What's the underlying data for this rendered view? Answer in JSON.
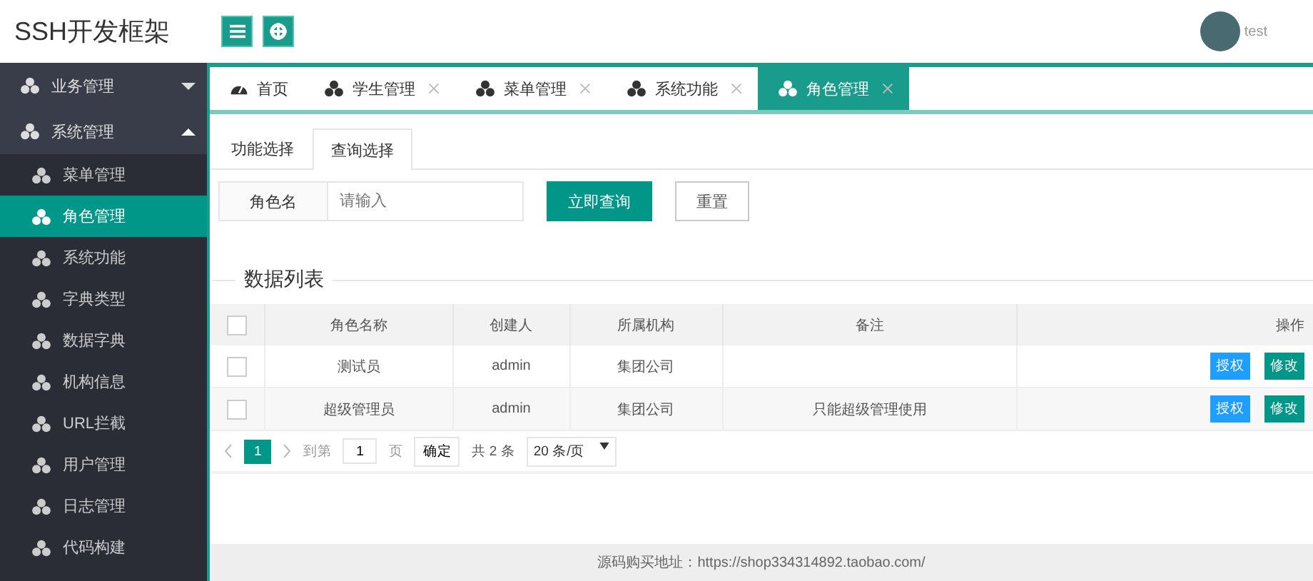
{
  "header": {
    "title": "SSH开发框架",
    "user": "test"
  },
  "sidebar": {
    "groups": [
      {
        "label": "业务管理",
        "expanded": false
      },
      {
        "label": "系统管理",
        "expanded": true,
        "children": [
          {
            "label": "菜单管理",
            "selected": false
          },
          {
            "label": "角色管理",
            "selected": true
          },
          {
            "label": "系统功能",
            "selected": false
          },
          {
            "label": "字典类型",
            "selected": false
          },
          {
            "label": "数据字典",
            "selected": false
          },
          {
            "label": "机构信息",
            "selected": false
          },
          {
            "label": "URL拦截",
            "selected": false
          },
          {
            "label": "用户管理",
            "selected": false
          },
          {
            "label": "日志管理",
            "selected": false
          },
          {
            "label": "代码构建",
            "selected": false
          }
        ]
      }
    ]
  },
  "tabs": [
    {
      "label": "首页",
      "kind": "home",
      "closable": false,
      "selected": false
    },
    {
      "label": "学生管理",
      "kind": "page",
      "closable": true,
      "selected": false
    },
    {
      "label": "菜单管理",
      "kind": "page",
      "closable": true,
      "selected": false
    },
    {
      "label": "系统功能",
      "kind": "page",
      "closable": true,
      "selected": false
    },
    {
      "label": "角色管理",
      "kind": "page",
      "closable": true,
      "selected": true
    }
  ],
  "subtabs": [
    {
      "label": "功能选择",
      "selected": false
    },
    {
      "label": "查询选择",
      "selected": true
    }
  ],
  "search": {
    "label": "角色名",
    "placeholder": "请输入",
    "query_button": "立即查询",
    "reset_button": "重置"
  },
  "section_title": "数据列表",
  "table": {
    "all_checked": false,
    "columns": [
      "角色名称",
      "创建人",
      "所属机构",
      "备注",
      "操作"
    ],
    "rows": [
      {
        "checked": false,
        "cells": [
          "测试员",
          "admin",
          "集团公司",
          ""
        ],
        "actions": [
          "授权",
          "修改"
        ]
      },
      {
        "checked": false,
        "cells": [
          "超级管理员",
          "admin",
          "集团公司",
          "只能超级管理使用"
        ],
        "actions": [
          "授权",
          "修改"
        ]
      }
    ]
  },
  "pagination": {
    "pages": [
      {
        "label": "1",
        "selected": true
      }
    ],
    "goto_label": "到第",
    "goto_value": "1",
    "page_unit": "页",
    "confirm": "确定",
    "total": "共 2 条",
    "page_size": "20 条/页"
  },
  "footer": "源码购买地址：https://shop334314892.taobao.com/"
}
